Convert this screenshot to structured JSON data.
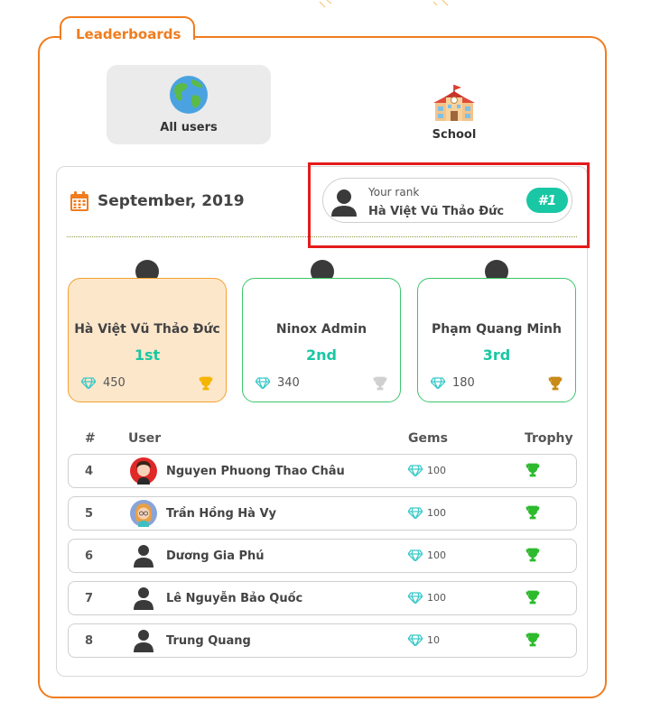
{
  "header": {
    "title": "Leaderboards"
  },
  "tabs": [
    {
      "label": "All users",
      "icon": "globe-icon",
      "active": true
    },
    {
      "label": "School",
      "icon": "school-building-icon",
      "active": false
    }
  ],
  "period": {
    "label": "September, 2019",
    "icon": "calendar-icon"
  },
  "your_rank": {
    "caption": "Your rank",
    "name": "Hà Việt Vũ Thảo Đức",
    "rank": "#1"
  },
  "podium": [
    {
      "name": "Hà Việt Vũ Thảo Đức",
      "place": "1st",
      "gems": "450",
      "trophy_color": "#f5b400"
    },
    {
      "name": "Ninox Admin",
      "place": "2nd",
      "gems": "340",
      "trophy_color": "#d0d0d0"
    },
    {
      "name": "Phạm Quang Minh",
      "place": "3rd",
      "gems": "180",
      "trophy_color": "#c98a18"
    }
  ],
  "table": {
    "headers": {
      "rank": "#",
      "user": "User",
      "gems": "Gems",
      "trophy": "Trophy"
    },
    "rows": [
      {
        "rank": "4",
        "name": "Nguyen Phuong Thao Châu",
        "gems": "100",
        "avatar": "girl-avatar-red"
      },
      {
        "rank": "5",
        "name": "Trần Hồng Hà Vy",
        "gems": "100",
        "avatar": "girl-avatar-blonde"
      },
      {
        "rank": "6",
        "name": "Dương Gia Phú",
        "gems": "100",
        "avatar": "default-avatar"
      },
      {
        "rank": "7",
        "name": "Lê Nguyễn Bảo Quốc",
        "gems": "100",
        "avatar": "default-avatar"
      },
      {
        "rank": "8",
        "name": "Trung Quang",
        "gems": "10",
        "avatar": "default-avatar"
      }
    ]
  },
  "colors": {
    "accent": "#f07c1e",
    "teal": "#19c7a4",
    "green": "#3cc56b",
    "highlight": "#e41b1b",
    "gem": "#3cc9c9",
    "row_trophy": "#2dbb2d"
  }
}
